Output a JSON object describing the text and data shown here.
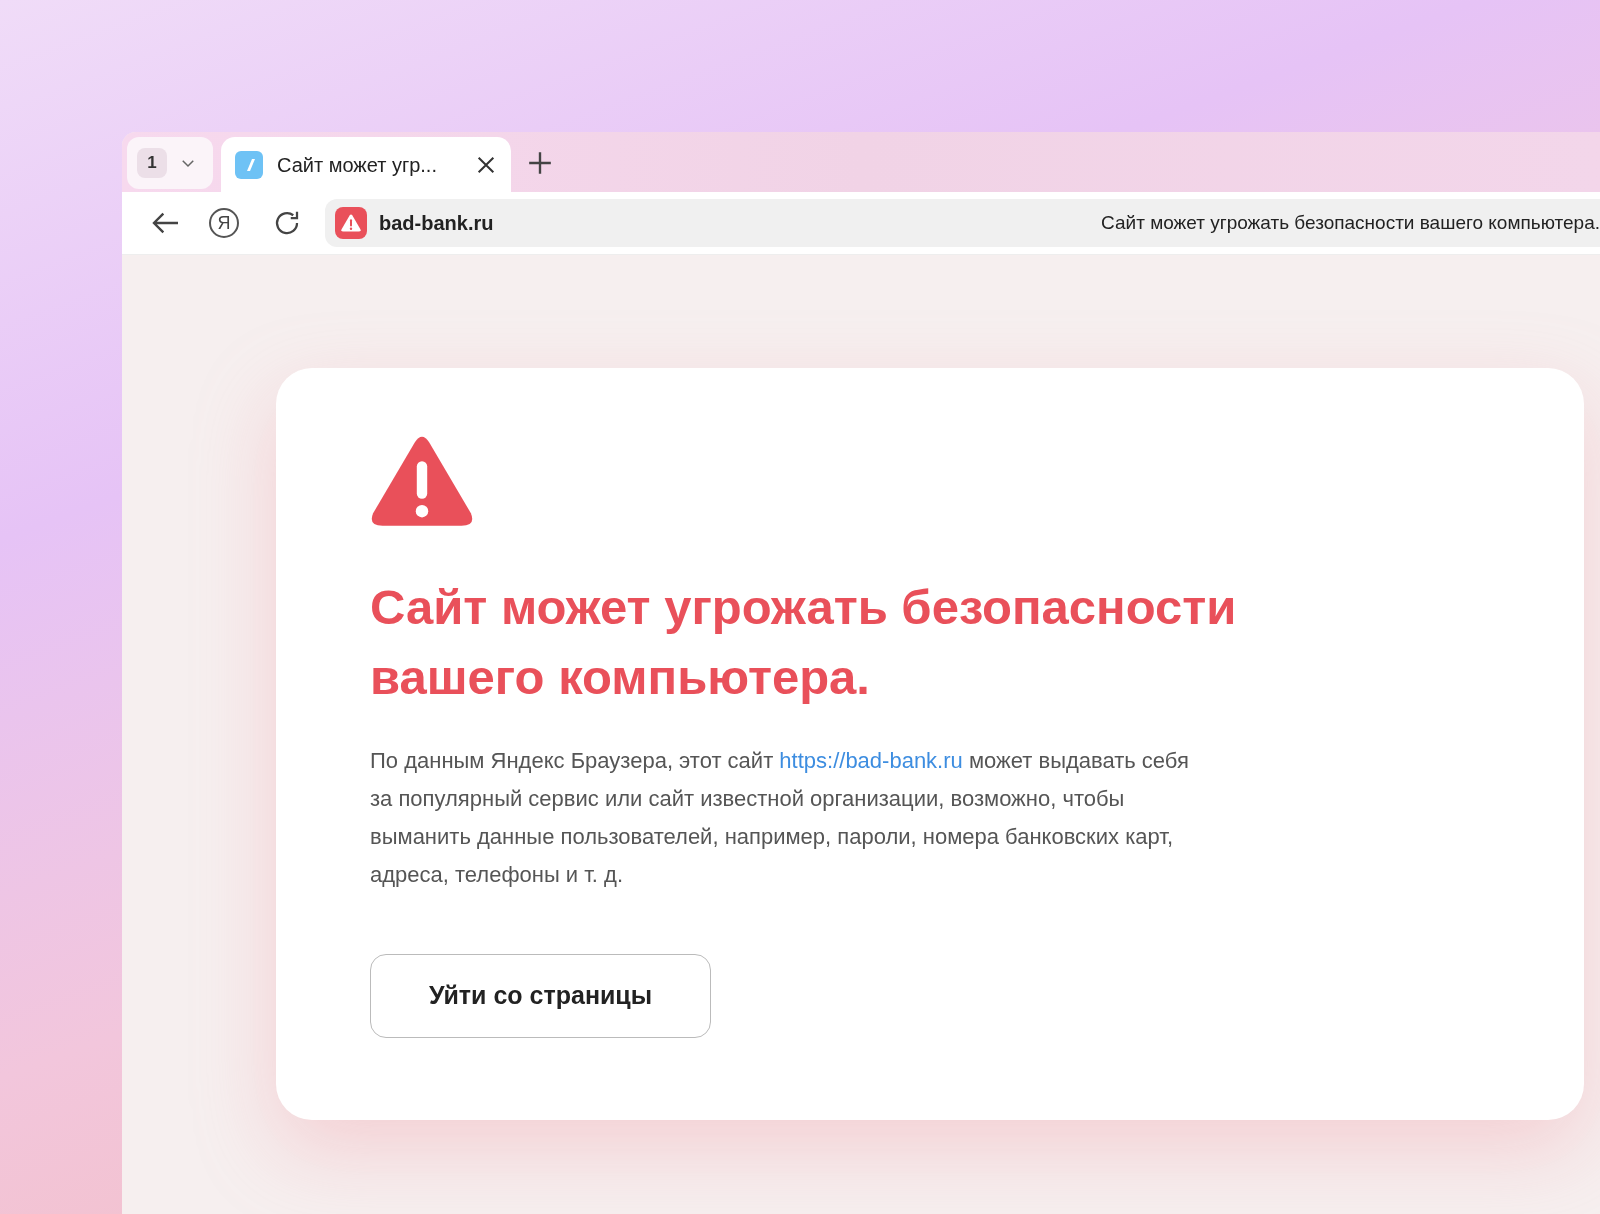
{
  "tab_group": {
    "count": "1"
  },
  "tabs": [
    {
      "title": "Сайт может угр...",
      "selected": true
    }
  ],
  "toolbar": {
    "yandex_button": "Я"
  },
  "address_bar": {
    "domain": "bad-bank.ru",
    "status": "Сайт может угрожать безопасности вашего компьютера."
  },
  "warning": {
    "title": "Сайт может угрожать безопасности вашего компьютера.",
    "text_before": "По данным Яндекс Браузера, этот сайт",
    "link": "https://bad-bank.ru",
    "text_after": "может выдавать себя за популярный сервис или сайт известной организации, возможно, чтобы выманить данные пользователей, например, пароли, номера банковских карт, адреса, телефоны и т. д.",
    "button": "Уйти со страницы"
  }
}
